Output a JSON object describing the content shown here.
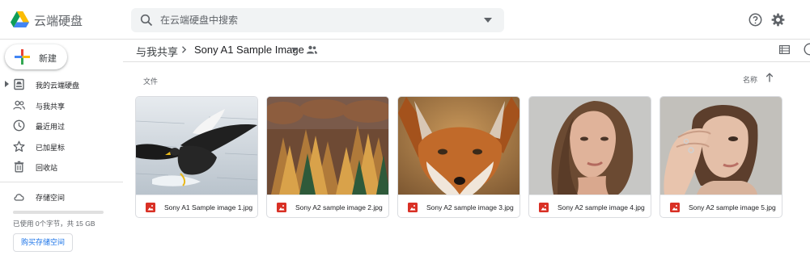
{
  "header": {
    "app_name": "云端硬盘",
    "search_placeholder": "在云端硬盘中搜索"
  },
  "sidebar": {
    "new_label": "新建",
    "items": [
      {
        "label": "我的云端硬盘",
        "icon": "my-drive-icon"
      },
      {
        "label": "与我共享",
        "icon": "shared-with-me-icon"
      },
      {
        "label": "最近用过",
        "icon": "clock-icon"
      },
      {
        "label": "已加星标",
        "icon": "star-icon"
      },
      {
        "label": "回收站",
        "icon": "trash-icon"
      },
      {
        "label": "存储空间",
        "icon": "cloud-icon"
      }
    ],
    "storage_used_text": "已使用 0个字节，共 15 GB",
    "storage_used_fraction": 0,
    "buy_storage_label": "购买存储空间"
  },
  "breadcrumb": {
    "parent": "与我共享",
    "current": "Sony A1 Sample Image"
  },
  "main": {
    "section_label": "文件",
    "sort_label": "名称"
  },
  "files": [
    {
      "name": "Sony A1 Sample image 1.jpg",
      "thumb": "eagle"
    },
    {
      "name": "Sony A2 sample image 2.jpg",
      "thumb": "autumn-forest"
    },
    {
      "name": "Sony A2 sample image 3.jpg",
      "thumb": "fox"
    },
    {
      "name": "Sony A2 sample image 4.jpg",
      "thumb": "portrait-woman"
    },
    {
      "name": "Sony A2 sample image 5.jpg",
      "thumb": "portrait-hand"
    }
  ],
  "colors": {
    "accent": "#1a73e8",
    "image_file_icon": "#d93025"
  }
}
